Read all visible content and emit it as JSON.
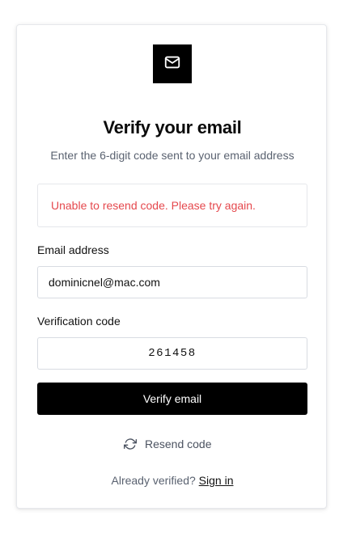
{
  "header": {
    "logo_icon": "envelope-icon",
    "title": "Verify your email",
    "subtitle": "Enter the 6-digit code sent to your email address"
  },
  "alert": {
    "message": "Unable to resend code. Please try again.",
    "color": "#e5484d"
  },
  "form": {
    "email_label": "Email address",
    "email_value": "dominicnel@mac.com",
    "code_label": "Verification code",
    "code_value": "261458",
    "submit_label": "Verify email"
  },
  "resend": {
    "icon": "refresh-icon",
    "label": "Resend code"
  },
  "footer": {
    "prompt": "Already verified?",
    "link_label": "Sign in"
  },
  "colors": {
    "primary": "#000000",
    "error": "#e5484d",
    "muted_text": "#5a6270"
  }
}
